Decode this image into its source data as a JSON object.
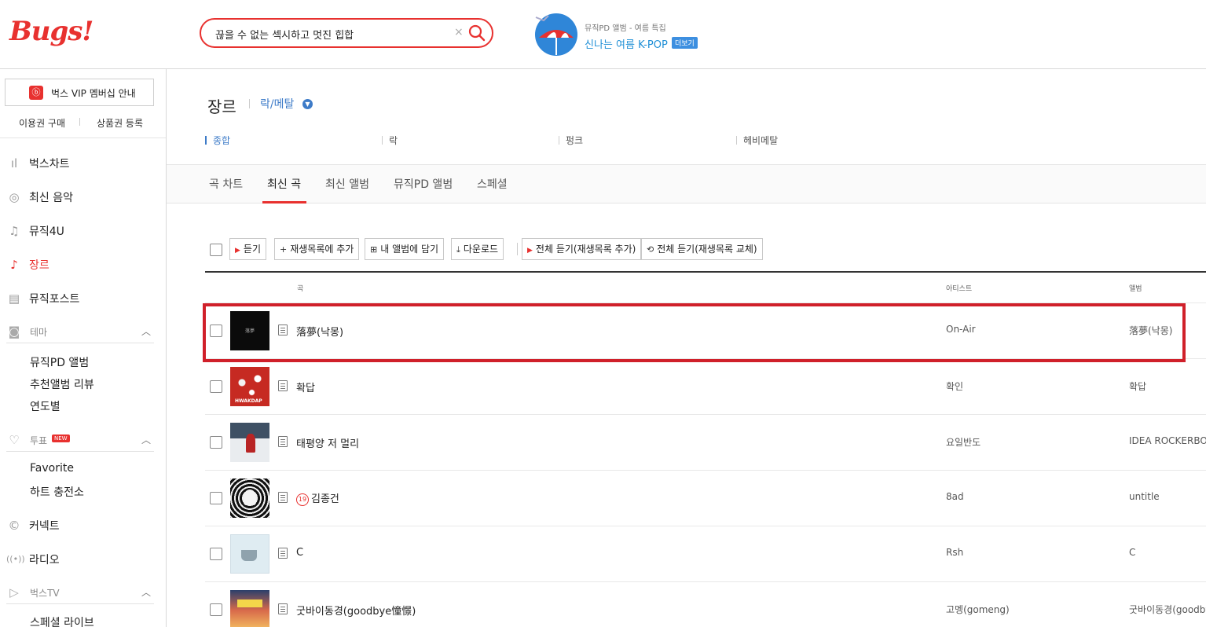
{
  "header": {
    "logo": "Bugs!",
    "search_value": "끊을 수 없는 섹시하고 멋진 힙합",
    "search_clear": "×",
    "promo_sub": "뮤직PD 앨범 - 여름 특집",
    "promo_title": "신나는 여름 K-POP",
    "promo_more": "더보기"
  },
  "sidebar": {
    "vip_label": "벅스 VIP 멤버십 안내",
    "vip_icon": "ⓑ",
    "buy_label": "이용권 구매",
    "coupon_label": "상품권 등록",
    "nav": [
      {
        "label": "벅스차트",
        "icon": "chart-icon",
        "glyph": "ıl"
      },
      {
        "label": "최신 음악",
        "icon": "new-music-icon",
        "glyph": "◎"
      },
      {
        "label": "뮤직4U",
        "icon": "note-icon",
        "glyph": "♫"
      },
      {
        "label": "장르",
        "icon": "guitar-icon",
        "glyph": "♪"
      },
      {
        "label": "뮤직포스트",
        "icon": "post-icon",
        "glyph": "▤"
      }
    ],
    "theme_label": "테마",
    "theme_items": [
      "뮤직PD 앨범",
      "추천앨범 리뷰",
      "연도별"
    ],
    "vote_label": "투표",
    "vote_badge": "NEW",
    "vote_items": [
      "Favorite",
      "하트 충전소"
    ],
    "connect_label": "커넥트",
    "radio_label": "라디오",
    "tv_label": "벅스TV",
    "tv_items": [
      "스페셜 라이브"
    ]
  },
  "main": {
    "title": "장르",
    "genre_selected": "락/메탈",
    "subgenres": [
      "종합",
      "락",
      "펑크",
      "헤비메탈"
    ],
    "tabs": [
      "곡 차트",
      "최신 곡",
      "최신 앨범",
      "뮤직PD 앨범",
      "스페셜"
    ],
    "toolbar": {
      "listen": "듣기",
      "add_playlist": "재생목록에 추가",
      "add_album": "내 앨범에 담기",
      "download": "다운로드",
      "listen_all_add": "전체 듣기(재생목록 추가)",
      "listen_all_replace": "전체 듣기(재생목록 교체)"
    },
    "columns": {
      "song": "곡",
      "artist": "아티스트",
      "album": "앨범"
    },
    "rows": [
      {
        "title": "落夢(낙몽)",
        "artist": "On-Air",
        "album": "落夢(낙몽)",
        "age": "",
        "thumb_text": "落夢"
      },
      {
        "title": "확답",
        "artist": "확인",
        "album": "확답",
        "age": "",
        "thumb_text": "HWAKDAP"
      },
      {
        "title": "태평양 저 멀리",
        "artist": "요일반도",
        "album": "IDEA ROCKERBOY",
        "age": "",
        "thumb_text": ""
      },
      {
        "title": "김종건",
        "artist": "8ad",
        "album": "untitle",
        "age": "19",
        "thumb_text": ""
      },
      {
        "title": "C",
        "artist": "Rsh",
        "album": "C",
        "age": "",
        "thumb_text": ""
      },
      {
        "title": "굿바이동경(goodbye憧憬)",
        "artist": "고멩(gomeng)",
        "album": "굿바이동경(goodbye憧憬)",
        "age": "",
        "thumb_text": ""
      }
    ]
  },
  "colors": {
    "accent": "#e8312f",
    "link_blue": "#3d7bc8",
    "highlight_border": "#d0202a"
  }
}
